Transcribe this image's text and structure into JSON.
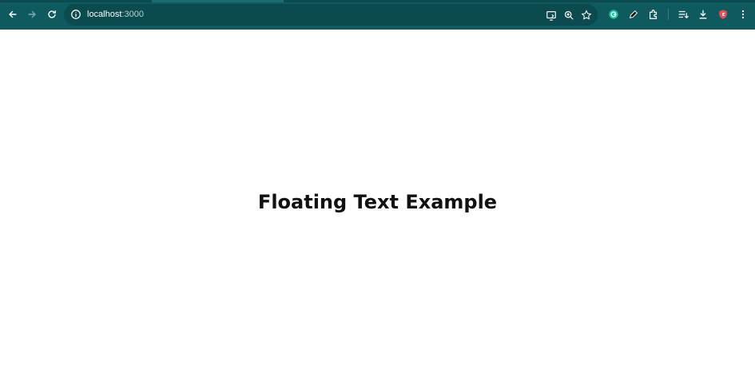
{
  "browser": {
    "url_host": "localhost",
    "url_port": ":3000",
    "toolbar_color": "#0f5a5f",
    "icons": {
      "back": "arrow-left-icon",
      "forward": "arrow-right-icon",
      "reload": "reload-icon",
      "site_info": "info-icon",
      "cast": "cast-icon",
      "zoom": "zoom-icon",
      "bookmark": "star-icon",
      "grammarly": "grammarly-icon",
      "pen": "pen-icon",
      "extensions": "puzzle-icon",
      "reading_list": "reading-list-icon",
      "downloads": "download-icon",
      "shield": "shield-icon",
      "menu": "kebab-menu-icon"
    }
  },
  "page": {
    "heading": "Floating Text Example"
  }
}
